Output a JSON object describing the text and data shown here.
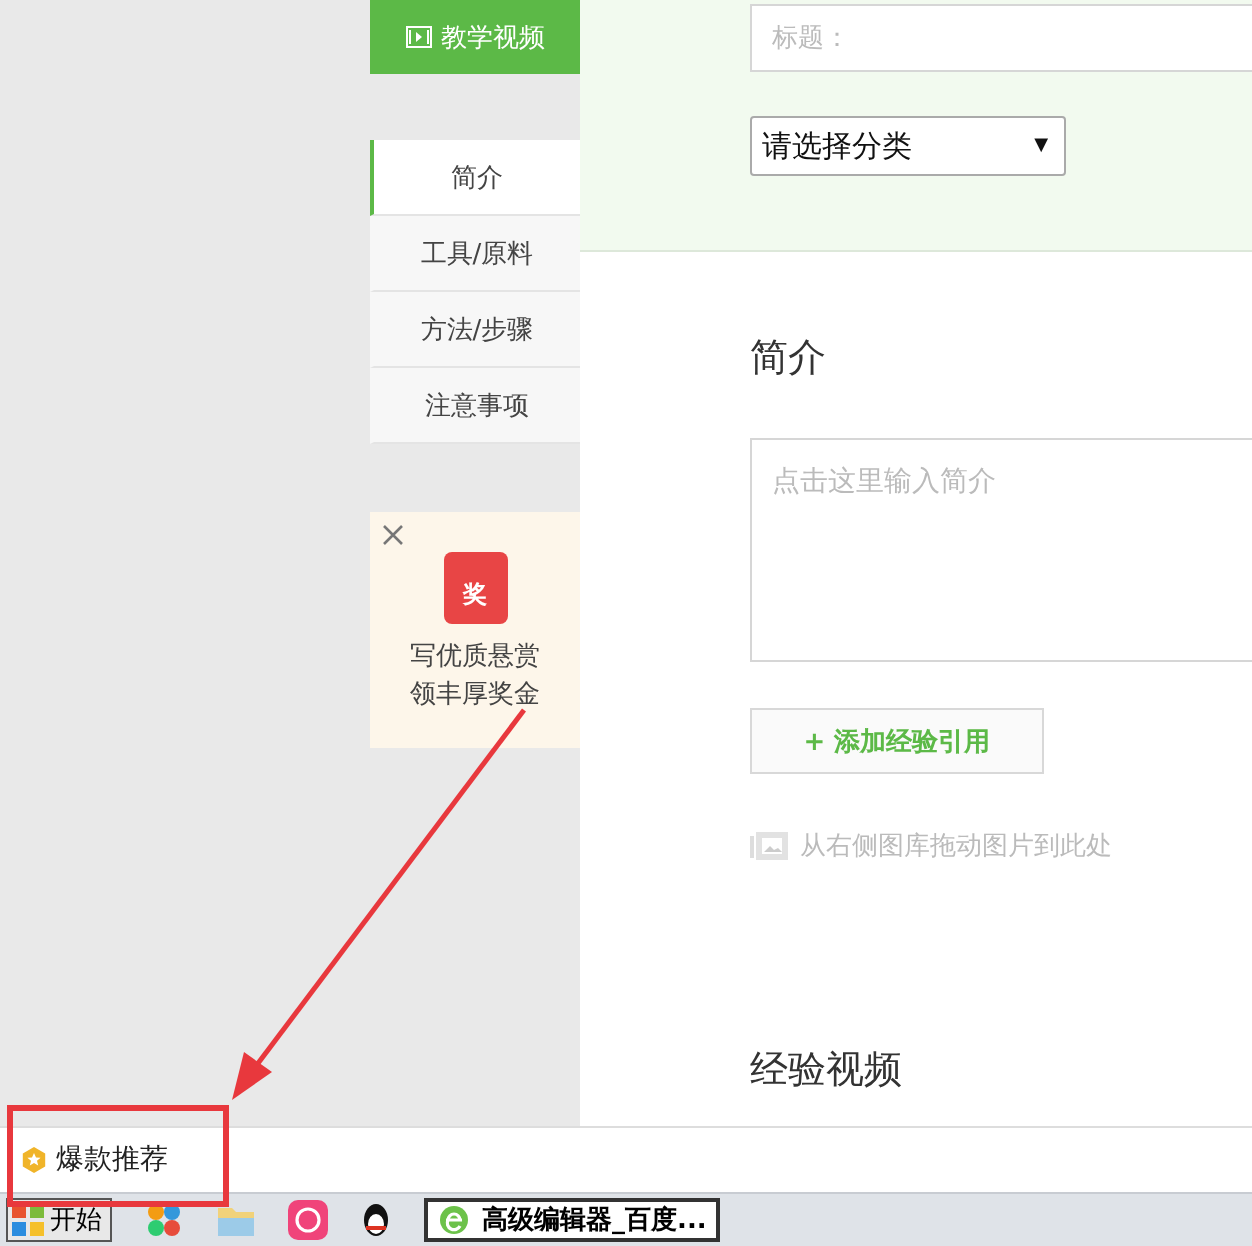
{
  "sidebar": {
    "video_button": {
      "label": "教学视频"
    },
    "items": [
      {
        "label": "简介",
        "selected": true
      },
      {
        "label": "工具/原料",
        "selected": false
      },
      {
        "label": "方法/步骤",
        "selected": false
      },
      {
        "label": "注意事项",
        "selected": false
      }
    ],
    "promo": {
      "badge": "奖",
      "lines": [
        "写优质悬赏",
        "领丰厚奖金"
      ]
    }
  },
  "form": {
    "title_field": {
      "placeholder": "标题："
    },
    "category_select": {
      "value": "请选择分类",
      "arrow": "▼"
    }
  },
  "intro": {
    "heading": "简介",
    "textarea": {
      "placeholder": "点击这里输入简介"
    },
    "add_button": {
      "label": "+ 添加经验引用"
    },
    "image_hint": "从右侧图库拖动图片到此处"
  },
  "video_section": {
    "heading": "经验视频"
  },
  "bottom_bar": {
    "label": "爆款推荐"
  },
  "taskbar": {
    "start": "开始",
    "task": {
      "label": "高级编辑器_百度...",
      "selected": true
    }
  }
}
